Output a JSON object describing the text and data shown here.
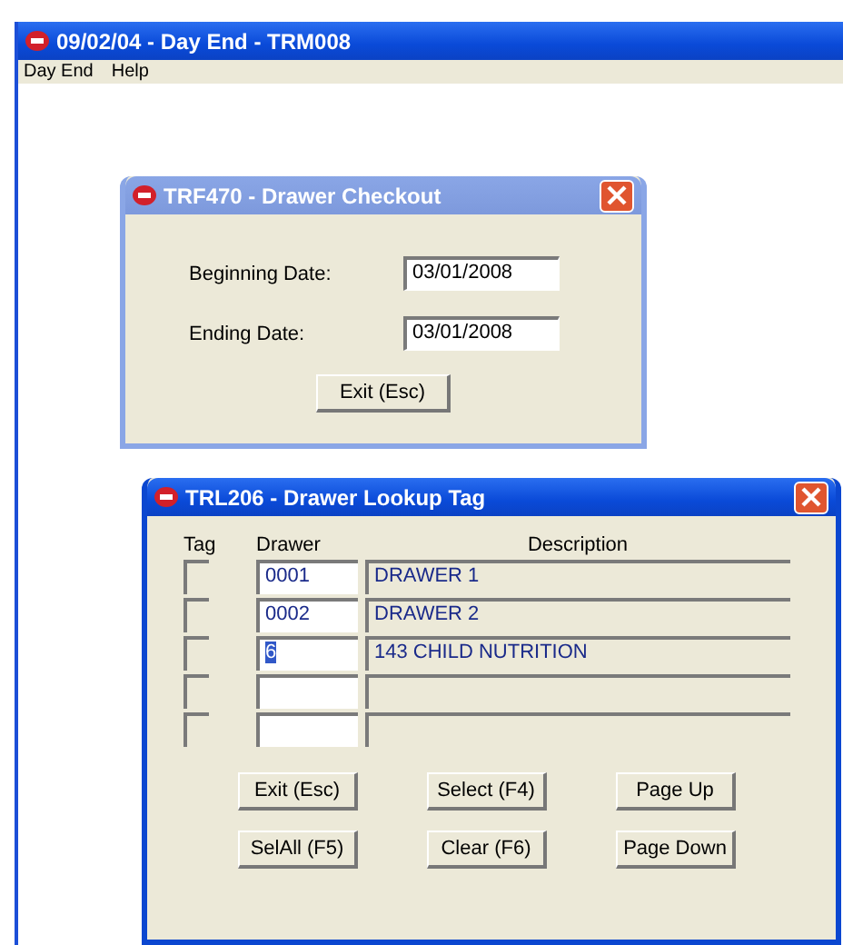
{
  "window": {
    "title": "09/02/04 - Day End - TRM008"
  },
  "menu": [
    "Day End",
    "Help"
  ],
  "checkout_dialog": {
    "title": "TRF470 - Drawer Checkout",
    "active": false,
    "fields": [
      {
        "label": "Beginning Date:",
        "value": "03/01/2008"
      },
      {
        "label": "Ending Date:",
        "value": "03/01/2008"
      }
    ],
    "button": "Exit (Esc)"
  },
  "lookup_dialog": {
    "title": "TRL206 - Drawer Lookup Tag",
    "active": true,
    "columns": [
      "Tag",
      "Drawer",
      "Description"
    ],
    "rows": [
      {
        "checked": false,
        "drawer": "0001",
        "description": "DRAWER 1",
        "highlighted": false
      },
      {
        "checked": false,
        "drawer": "0002",
        "description": "DRAWER 2",
        "highlighted": false
      },
      {
        "checked": false,
        "drawer": "6",
        "description": "143 CHILD NUTRITION",
        "highlighted": true
      },
      {
        "checked": false,
        "drawer": "",
        "description": "",
        "highlighted": false
      },
      {
        "checked": false,
        "drawer": "",
        "description": "",
        "highlighted": false
      }
    ],
    "buttons": [
      "Exit (Esc)",
      "Select (F4)",
      "Page Up",
      "SelAll (F5)",
      "Clear (F6)",
      "Page Down"
    ]
  }
}
